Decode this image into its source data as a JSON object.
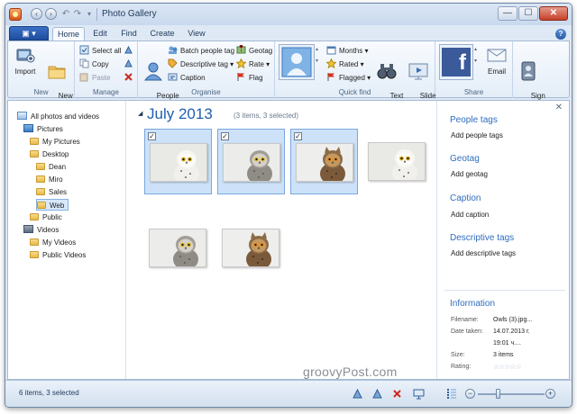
{
  "window": {
    "title": "Photo Gallery",
    "controls": {
      "minimize": "—",
      "maximize": "☐",
      "close": "✕"
    }
  },
  "quick_access": {
    "back": "‹",
    "forward": "›",
    "undo": "↶",
    "redo": "↷",
    "customize": "▾"
  },
  "tabs": {
    "file": "▣ ▾",
    "items": [
      "Home",
      "Edit",
      "Find",
      "Create",
      "View"
    ],
    "active": "Home",
    "help": "?"
  },
  "ribbon": {
    "new": {
      "label": "New",
      "import": "Import",
      "new_folder": "New\nfolder"
    },
    "manage": {
      "label": "Manage",
      "select_all": "Select all",
      "copy": "Copy",
      "paste": "Paste"
    },
    "organise": {
      "label": "Organise",
      "people_tag": "People\ntag ▾",
      "batch_people_tag": "Batch people tag",
      "descriptive_tag": "Descriptive tag ▾",
      "caption": "Caption",
      "geotag": "Geotag",
      "rate": "Rate ▾",
      "flag": "Flag"
    },
    "quick_find": {
      "label": "Quick find",
      "months": "Months ▾",
      "rated": "Rated ▾",
      "flagged": "Flagged ▾",
      "text_search": "Text\nsearch",
      "slide_show": "Slide\nshow ▾"
    },
    "share": {
      "label": "Share",
      "email": "Email",
      "facebook_glyph": "f"
    },
    "sign_in": "Sign\nin"
  },
  "navigation": [
    {
      "label": "All photos and videos",
      "icon": "all-photos-icon",
      "indent": 0
    },
    {
      "label": "Pictures",
      "icon": "pictures-icon",
      "indent": 1
    },
    {
      "label": "My Pictures",
      "icon": "folder-icon",
      "indent": 2
    },
    {
      "label": "Desktop",
      "icon": "folder-icon",
      "indent": 2
    },
    {
      "label": "Dean",
      "icon": "folder-icon",
      "indent": 3
    },
    {
      "label": "Miro",
      "icon": "folder-icon",
      "indent": 3
    },
    {
      "label": "Sales",
      "icon": "folder-icon",
      "indent": 3
    },
    {
      "label": "Web",
      "icon": "folder-icon",
      "indent": 3,
      "selected": true
    },
    {
      "label": "Public",
      "icon": "folder-icon",
      "indent": 2
    },
    {
      "label": "Videos",
      "icon": "videos-icon",
      "indent": 1
    },
    {
      "label": "My Videos",
      "icon": "folder-icon",
      "indent": 2
    },
    {
      "label": "Public Videos",
      "icon": "folder-icon",
      "indent": 2
    }
  ],
  "gallery": {
    "collapse_glyph": "◢",
    "group_title": "July 2013",
    "group_count": "(3 items, 3 selected)",
    "check_glyph": "✓",
    "photos": [
      {
        "name": "snowy-owl-photo",
        "kind": "snowy",
        "selected": true
      },
      {
        "name": "great-grey-owl-photo",
        "kind": "grey",
        "selected": true
      },
      {
        "name": "eagle-owl-photo",
        "kind": "eagle",
        "selected": true
      },
      {
        "name": "snowy-owl-photo",
        "kind": "snowy",
        "selected": false
      },
      {
        "name": "great-grey-owl-photo",
        "kind": "grey",
        "selected": false
      },
      {
        "name": "eagle-owl-photo",
        "kind": "eagle",
        "selected": false
      }
    ]
  },
  "details": {
    "close": "✕",
    "people_tags": {
      "title": "People tags",
      "action": "Add people tags"
    },
    "geotag": {
      "title": "Geotag",
      "action": "Add geotag"
    },
    "caption": {
      "title": "Caption",
      "action": "Add caption"
    },
    "descriptive_tags": {
      "title": "Descriptive tags",
      "action": "Add descriptive tags"
    },
    "information": {
      "title": "Information",
      "filename_label": "Filename:",
      "filename": "Owls (3).jpg...",
      "date_label": "Date taken:",
      "date": "14.07.2013 г.",
      "time": "19:01 ч....",
      "size_label": "Size:",
      "size": "3 items",
      "rating_label": "Rating:",
      "rating_stars": "☆☆☆☆☆"
    }
  },
  "watermark": "groovyPost.com",
  "statusbar": {
    "text": "6 items, 3 selected",
    "zoom_minus": "−",
    "zoom_plus": "+",
    "zoom_level": 0.3
  }
}
